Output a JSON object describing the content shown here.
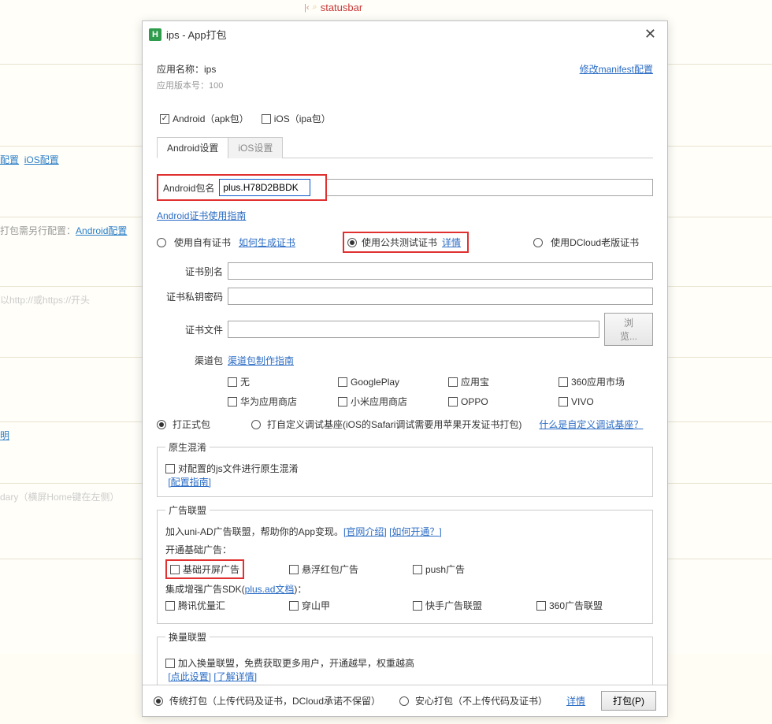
{
  "statusbar": "statusbar",
  "bg": {
    "cfg": "配置",
    "ios_cfg": "iOS配置",
    "pack_cfg_pre": "打包需另行配置：",
    "android_cfg": "Android配置",
    "url_hint": "以http://或https://开头",
    "ming": "明",
    "dary": "dary（横屏Home键在左侧）"
  },
  "win": {
    "title": "ips - App打包",
    "app_name_label": "应用名称：",
    "app_name": "ips",
    "app_ver_label": "应用版本号：",
    "app_ver": "100",
    "modify_manifest": "修改manifest配置",
    "android_pkg": "Android（apk包）",
    "ios_pkg": "iOS（ipa包）",
    "tab_android": "Android设置",
    "tab_ios": "iOS设置",
    "pkg_label": "Android包名",
    "pkg_value": "plus.H78D2BBDK",
    "cert_guide": "Android证书使用指南",
    "cert_own": "使用自有证书",
    "how_gen": "如何生成证书",
    "cert_public": "使用公共测试证书",
    "detail": "详情",
    "cert_dcloud": "使用DCloud老版证书",
    "cert_alias": "证书别名",
    "cert_pwd": "证书私钥密码",
    "cert_file": "证书文件",
    "browse": "浏览...",
    "channel_label": "渠道包",
    "channel_guide": "渠道包制作指南",
    "ch": {
      "none": "无",
      "gp": "GooglePlay",
      "yyb": "应用宝",
      "s360": "360应用市场",
      "hw": "华为应用商店",
      "mi": "小米应用商店",
      "oppo": "OPPO",
      "vivo": "VIVO"
    },
    "pack_release": "打正式包",
    "pack_custom": "打自定义调试基座(iOS的Safari调试需要用苹果开发证书打包)",
    "what_custom": "什么是自定义调试基座？",
    "native_legend": "原生混淆",
    "native_mix": "对配置的js文件进行原生混淆",
    "cfg_guide": "[配置指南]",
    "ad_legend": "广告联盟",
    "ad_intro_pre": "加入uni-AD广告联盟，帮助你的App变现。",
    "ad_intro_link1": "[官网介绍]",
    "ad_intro_link2": "[如何开通？]",
    "ad_basic_title": "开通基础广告：",
    "ad_splash": "基础开屏广告",
    "ad_redpack": "悬浮红包广告",
    "ad_push": "push广告",
    "ad_sdk_pre": "集成增强广告SDK(",
    "ad_sdk_link": "plus.ad文档",
    "ad_sdk_post": ")：",
    "ad_tx": "腾讯优量汇",
    "ad_csj": "穿山甲",
    "ad_ks": "快手广告联盟",
    "ad_360": "360广告联盟",
    "swap_legend": "换量联盟",
    "swap_text": "加入换量联盟，免费获取更多用户，开通越早，权重越高",
    "swap_link1": "[点此设置]",
    "swap_link2": "[了解详情]",
    "foot_traditional": "传统打包（上传代码及证书，DCloud承诺不保留）",
    "foot_safe": "安心打包（不上传代码及证书）",
    "foot_detail": "详情",
    "foot_btn": "打包(P)"
  }
}
